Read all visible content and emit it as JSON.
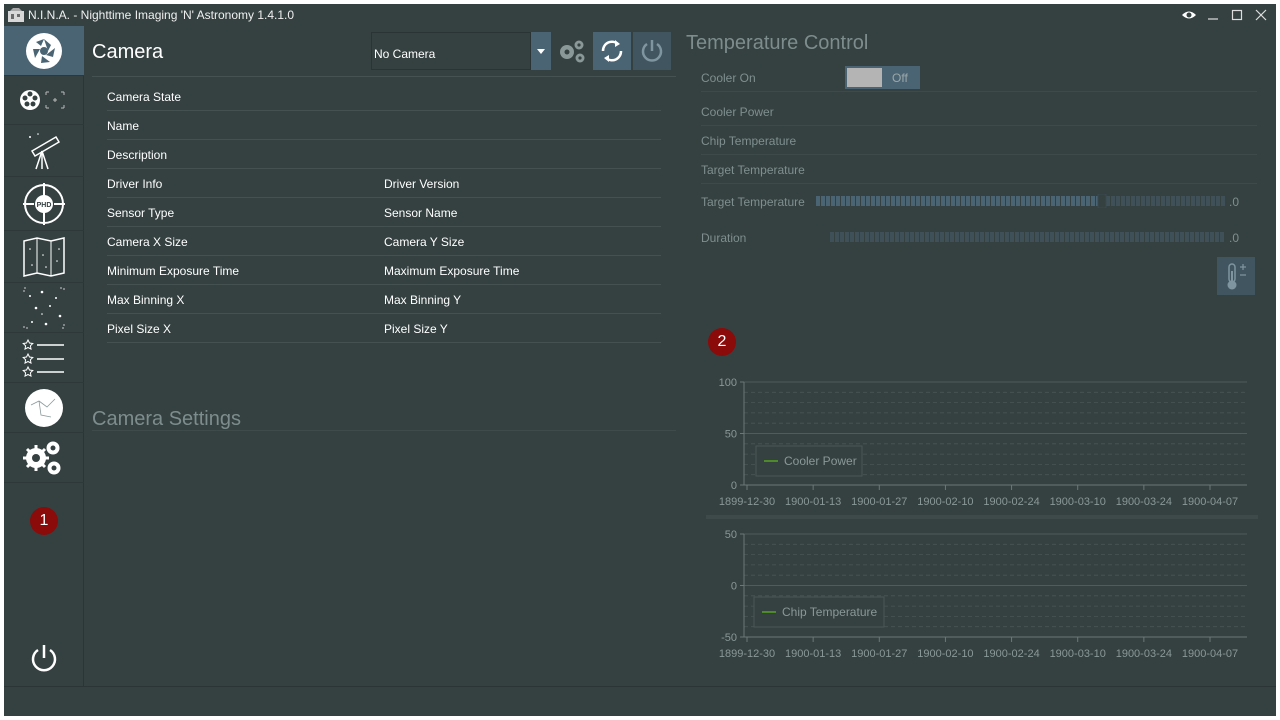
{
  "window": {
    "title": "N.I.N.A. - Nighttime Imaging 'N' Astronomy 1.4.1.0",
    "controls": [
      "eye-icon",
      "minimize-icon",
      "maximize-icon",
      "close-icon"
    ]
  },
  "sidebar": {
    "items": [
      {
        "icon": "camera-aperture-icon"
      },
      {
        "icon": "filter-wheel-icon"
      },
      {
        "icon": "telescope-icon"
      },
      {
        "icon": "phd-guider-icon"
      },
      {
        "icon": "sky-map-icon"
      },
      {
        "icon": "framing-stars-icon"
      },
      {
        "icon": "sequence-list-icon"
      },
      {
        "icon": "sky-atlas-icon"
      },
      {
        "icon": "settings-gears-icon"
      }
    ],
    "badge": "1",
    "power_icon": "power-icon"
  },
  "camera": {
    "title": "Camera",
    "selector_value": "No Camera",
    "rows": [
      {
        "left": "Camera State",
        "right": ""
      },
      {
        "left": "Name",
        "right": ""
      },
      {
        "left": "Description",
        "right": ""
      },
      {
        "left": "Driver Info",
        "right": "Driver Version"
      },
      {
        "left": "Sensor Type",
        "right": "Sensor Name"
      },
      {
        "left": "Camera X Size",
        "right": "Camera Y Size"
      },
      {
        "left": "Minimum Exposure Time",
        "right": "Maximum Exposure Time"
      },
      {
        "left": "Max Binning X",
        "right": "Max Binning Y"
      },
      {
        "left": "Pixel Size X",
        "right": "Pixel Size Y"
      }
    ],
    "settings_title": "Camera Settings"
  },
  "temperature": {
    "title": "Temperature Control",
    "cooler_on_label": "Cooler On",
    "cooler_toggle_text": "Off",
    "cooler_power_label": "Cooler Power",
    "chip_temp_label": "Chip Temperature",
    "target_temp_label": "Target Temperature",
    "target_temp_slider_label": "Target Temperature",
    "target_temp_value": ".0",
    "target_temp_fill": 0.7,
    "duration_label": "Duration",
    "duration_value": ".0",
    "badge": "2"
  },
  "chart_data": [
    {
      "type": "line",
      "series": [
        {
          "name": "Cooler Power",
          "values": []
        }
      ],
      "yticks": [
        "100",
        "50",
        "0"
      ],
      "ylim": [
        0,
        100
      ],
      "categories": [
        "1899-12-30",
        "1900-01-13",
        "1900-01-27",
        "1900-02-10",
        "1900-02-24",
        "1900-03-10",
        "1900-03-24",
        "1900-04-07"
      ],
      "legend": "Cooler Power",
      "color": "#4e8a2a"
    },
    {
      "type": "line",
      "series": [
        {
          "name": "Chip Temperature",
          "values": []
        }
      ],
      "yticks": [
        "50",
        "0",
        "-50"
      ],
      "ylim": [
        -50,
        50
      ],
      "categories": [
        "1899-12-30",
        "1900-01-13",
        "1900-01-27",
        "1900-02-10",
        "1900-02-24",
        "1900-03-10",
        "1900-03-24",
        "1900-04-07"
      ],
      "legend": "Chip Temperature",
      "color": "#4e8a2a"
    }
  ]
}
